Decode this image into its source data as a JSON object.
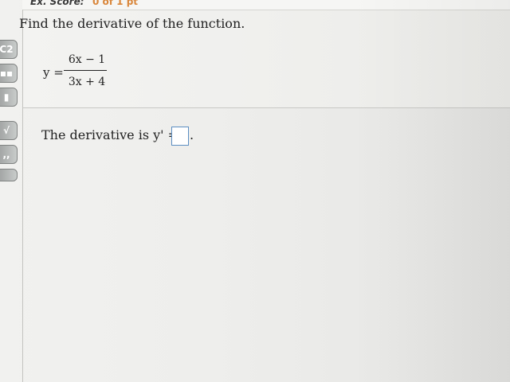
{
  "header": {
    "score_label": "Ex. Score:",
    "score_value": "0 of 1 pt"
  },
  "question": {
    "prompt": "Find the derivative of the function.",
    "lhs": "y =",
    "numerator": "6x − 1",
    "denominator": "3x + 4"
  },
  "answer": {
    "text": "The derivative is y' =",
    "input_value": "",
    "suffix": "."
  },
  "toolbar": {
    "buttons": [
      {
        "icon": "fraction-icon",
        "glyph": "C2"
      },
      {
        "icon": "matrix-icon",
        "glyph": "▪▪"
      },
      {
        "icon": "absolute-value-icon",
        "glyph": "▮"
      },
      {
        "icon": "square-root-icon",
        "glyph": "√"
      },
      {
        "icon": "interval-icon",
        "glyph": ",,"
      },
      {
        "icon": "more-tools-icon",
        "glyph": ""
      }
    ]
  },
  "colors": {
    "score_value": "#d9863a",
    "answer_box_border": "#5b8ec2"
  }
}
